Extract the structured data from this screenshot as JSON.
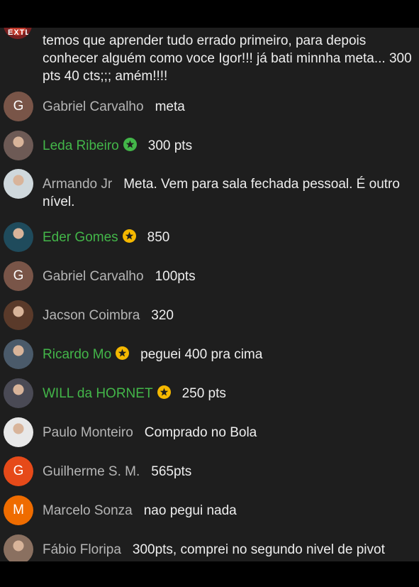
{
  "chat": {
    "top_message": {
      "avatar_text": "EXTLO",
      "text": "temos que aprender tudo errado primeiro, para depois conhecer alguém como voce Igor!!! já bati minnha meta... 300 pts 40 cts;;; amém!!!!"
    },
    "messages": [
      {
        "name": "Gabriel Carvalho",
        "text": "meta",
        "avatar_letter": "G",
        "avatar_color": "#795548",
        "member": false
      },
      {
        "name": "Leda Ribeiro",
        "text": "300 pts",
        "avatar_letter": "",
        "avatar_color": "#6d5a55",
        "member": true,
        "badge_color": "#43b649"
      },
      {
        "name": "Armando Jr",
        "text": "Meta. Vem para sala fechada pessoal. É outro nível.",
        "avatar_letter": "",
        "avatar_color": "#cfd8dc",
        "member": false
      },
      {
        "name": "Eder Gomes",
        "text": "850",
        "avatar_letter": "",
        "avatar_color": "#1f4b5c",
        "member": true,
        "badge_color": "#f5b800"
      },
      {
        "name": "Gabriel Carvalho",
        "text": "100pts",
        "avatar_letter": "G",
        "avatar_color": "#795548",
        "member": false
      },
      {
        "name": "Jacson Coimbra",
        "text": "320",
        "avatar_letter": "",
        "avatar_color": "#5a3a2a",
        "member": false
      },
      {
        "name": "Ricardo Mo",
        "text": "peguei 400 pra cima",
        "avatar_letter": "",
        "avatar_color": "#4a5a6a",
        "member": true,
        "badge_color": "#f5b800"
      },
      {
        "name": "WILL da HORNET",
        "text": "250 pts",
        "avatar_letter": "",
        "avatar_color": "#4a4a55",
        "member": true,
        "badge_color": "#f5b800"
      },
      {
        "name": "Paulo Monteiro",
        "text": "Comprado no Bola",
        "avatar_letter": "",
        "avatar_color": "#e8e8e8",
        "member": false
      },
      {
        "name": "Guilherme S. M.",
        "text": "565pts",
        "avatar_letter": "G",
        "avatar_color": "#e64a19",
        "member": false
      },
      {
        "name": "Marcelo Sonza",
        "text": "nao pegui nada",
        "avatar_letter": "M",
        "avatar_color": "#ef6c00",
        "member": false
      },
      {
        "name": "Fábio Floripa",
        "text": "300pts, comprei no segundo nivel de pivot",
        "avatar_letter": "",
        "avatar_color": "#8a7060",
        "member": false
      }
    ]
  }
}
